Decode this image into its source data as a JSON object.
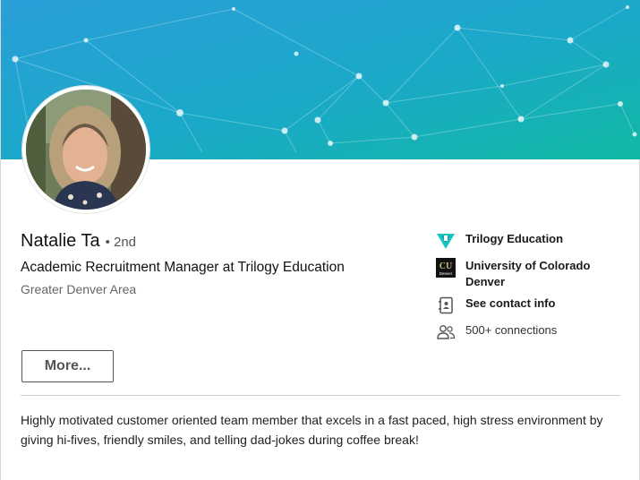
{
  "profile": {
    "name": "Natalie Ta",
    "degree": "• 2nd",
    "headline": "Academic Recruitment Manager at Trilogy Education",
    "location": "Greater Denver Area",
    "more_label": "More...",
    "summary": "Highly motivated customer oriented team member that excels in a fast paced, high stress environment by giving hi-fives, friendly smiles, and telling dad-jokes during coffee break!"
  },
  "sidebar": {
    "company": "Trilogy Education",
    "school": "University of Colorado Denver",
    "school_logo_text": "Denver",
    "contact": "See contact info",
    "connections": "500+ connections"
  },
  "colors": {
    "banner_start": "#25a7d6",
    "banner_end": "#13b7a6",
    "trilogy_teal": "#18c4c4"
  },
  "icons": {
    "company": "trilogy-logo-icon",
    "school": "cu-denver-logo-icon",
    "contact": "address-book-icon",
    "connections": "people-icon"
  }
}
